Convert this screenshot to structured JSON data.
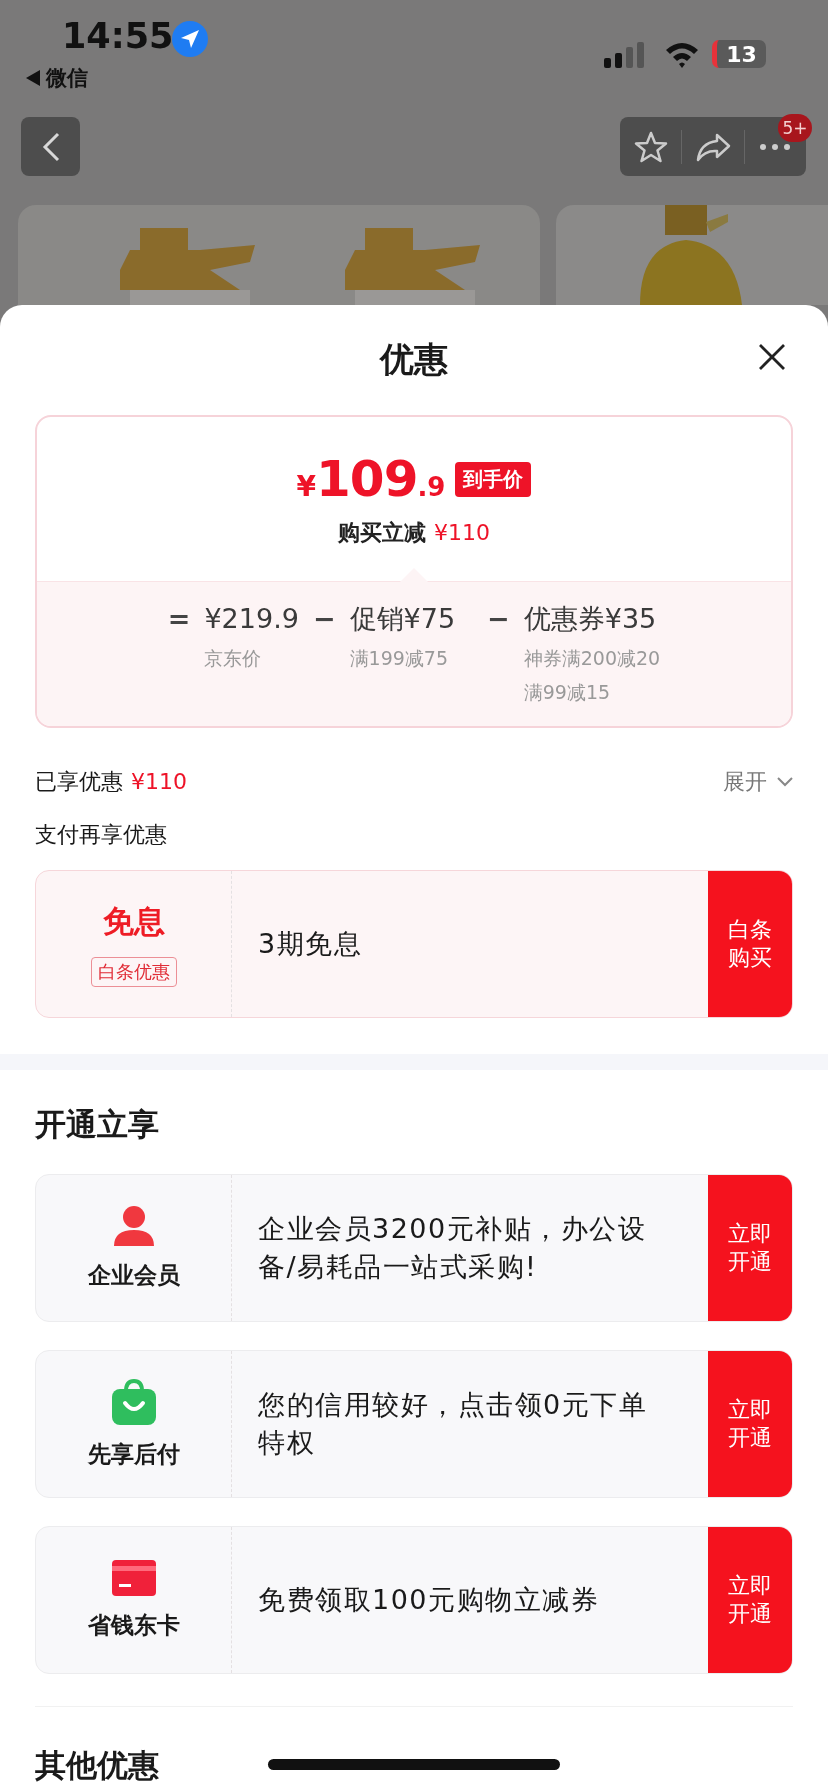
{
  "status_bar": {
    "time": "14:55",
    "back_app": "微信",
    "battery": "13"
  },
  "nav": {
    "badge": "5+"
  },
  "sheet": {
    "title": "优惠"
  },
  "price_card": {
    "currency": "¥",
    "integer": "109",
    "decimal": ".9",
    "tag": "到手价",
    "subtitle": "购买立减",
    "subtitle_amount": "¥110",
    "breakdown": [
      {
        "operator": "=",
        "amount": "¥219.9",
        "notes": [
          "京东价"
        ]
      },
      {
        "operator": "−",
        "label": "促销",
        "amount": "¥75",
        "notes": [
          "满199减75"
        ]
      },
      {
        "operator": "−",
        "label": "优惠券",
        "amount": "¥35",
        "notes": [
          "神券满200减20",
          "满99减15"
        ]
      }
    ]
  },
  "summary": {
    "label": "已享优惠",
    "amount": "¥110",
    "toggle": "展开",
    "expanded": false
  },
  "pay_section": {
    "title": "支付再享优惠",
    "offers": [
      {
        "kind": "tagged",
        "title": "免息",
        "tag": "白条优惠",
        "text": "3期免息",
        "button": "白条购买"
      }
    ]
  },
  "open_section": {
    "title": "开通立享",
    "offers": [
      {
        "kind": "person",
        "label": "企业会员",
        "text": "企业会员3200元补贴，办公设备/易耗品一站式采购!",
        "button": "立即开通"
      },
      {
        "kind": "bag",
        "label": "先享后付",
        "text": "您的信用较好，点击领0元下单特权",
        "button": "立即开通"
      },
      {
        "kind": "card",
        "label": "省钱东卡",
        "text": "免费领取100元购物立减券",
        "button": "立即开通"
      }
    ]
  },
  "other_section": {
    "title": "其他优惠"
  }
}
